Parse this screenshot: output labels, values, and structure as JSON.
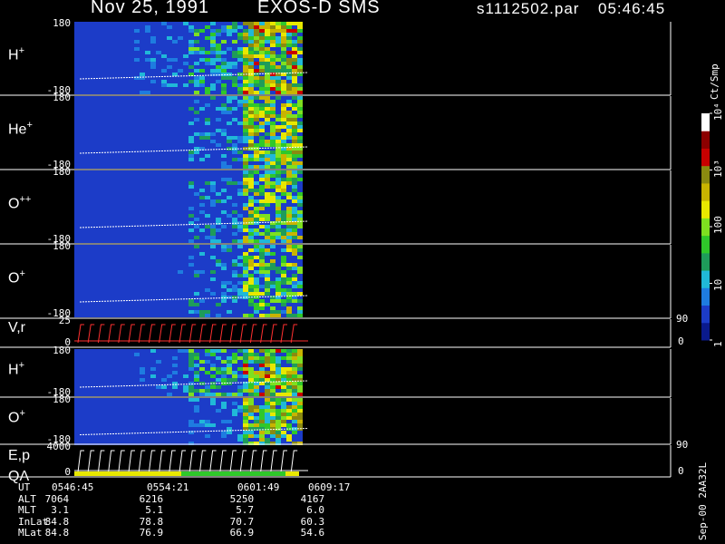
{
  "header": {
    "date": "Nov 25, 1991",
    "mission": "EXOS-D SMS",
    "file": "s1112502.par",
    "time": "05:46:45"
  },
  "side_label": "Sep-00 2AA32L",
  "chart_data": {
    "type": "heatmap",
    "title": "Nov 25, 1991   EXOS-D SMS",
    "colorbar": {
      "label": "Ct/Smp",
      "scale": "log",
      "range": [
        1,
        10000
      ],
      "tick_labels": [
        "1",
        "10",
        "100",
        "10³",
        "10⁴"
      ],
      "colors": [
        "#0a1a8c",
        "#1c3cc8",
        "#1e7ce0",
        "#20b8d8",
        "#1e9c5a",
        "#2fc82a",
        "#7ee020",
        "#e8e800",
        "#c8b400",
        "#8a8a10",
        "#c80000",
        "#8c0000",
        "#ffffff"
      ]
    },
    "panels": [
      {
        "name": "H+",
        "label_main": "H",
        "label_sup": "+",
        "ytop": "180",
        "ybot": "-180",
        "activity": [
          0.05,
          0.2,
          0.5,
          0.9
        ]
      },
      {
        "name": "He+",
        "label_main": "He",
        "label_sup": "+",
        "ytop": "180",
        "ybot": "-180",
        "activity": [
          0.02,
          0.05,
          0.3,
          0.8
        ]
      },
      {
        "name": "O++",
        "label_main": "O",
        "label_sup": "++",
        "ytop": "180",
        "ybot": "-180",
        "activity": [
          0.02,
          0.05,
          0.3,
          0.75
        ]
      },
      {
        "name": "O+",
        "label_main": "O",
        "label_sup": "+",
        "ytop": "180",
        "ybot": "-180",
        "activity": [
          0.02,
          0.06,
          0.3,
          0.7
        ]
      },
      {
        "name": "V,r",
        "label_main": "V,r",
        "label_sup": "",
        "ytop": "25",
        "ybot": "0",
        "right_top": "90",
        "right_bot": "0",
        "line_panel": true
      },
      {
        "name": "H+ (2)",
        "label_main": "H",
        "label_sup": "+",
        "ytop": "180",
        "ybot": "-180",
        "activity": [
          0.02,
          0.2,
          0.55,
          0.9
        ]
      },
      {
        "name": "O+ (2)",
        "label_main": "O",
        "label_sup": "+",
        "ytop": "180",
        "ybot": "-180",
        "activity": [
          0.02,
          0.05,
          0.25,
          0.85
        ]
      },
      {
        "name": "E,p QA",
        "label_main": "E,p",
        "label_sub2": "QA",
        "label_sup": "",
        "ytop": "4000",
        "ybot": "0",
        "right_top": "90",
        "right_bot": "0",
        "line_panel": true
      }
    ],
    "x_axis": {
      "labels": [
        "0546:45",
        "0554:21",
        "0601:49",
        "0609:17"
      ],
      "rows": [
        {
          "name": "UT",
          "values": [
            "0546:45",
            "0554:21",
            "0601:49",
            "0609:17"
          ]
        },
        {
          "name": "ALT",
          "values": [
            "7064",
            "6216",
            "5250",
            "4167"
          ]
        },
        {
          "name": "MLT",
          "values": [
            "3.1",
            "5.1",
            "5.7",
            "6.0"
          ]
        },
        {
          "name": "InLat",
          "values": [
            "84.8",
            "78.8",
            "70.7",
            "60.3"
          ]
        },
        {
          "name": "MLat",
          "values": [
            "84.8",
            "76.9",
            "66.9",
            "54.6"
          ]
        }
      ]
    }
  }
}
